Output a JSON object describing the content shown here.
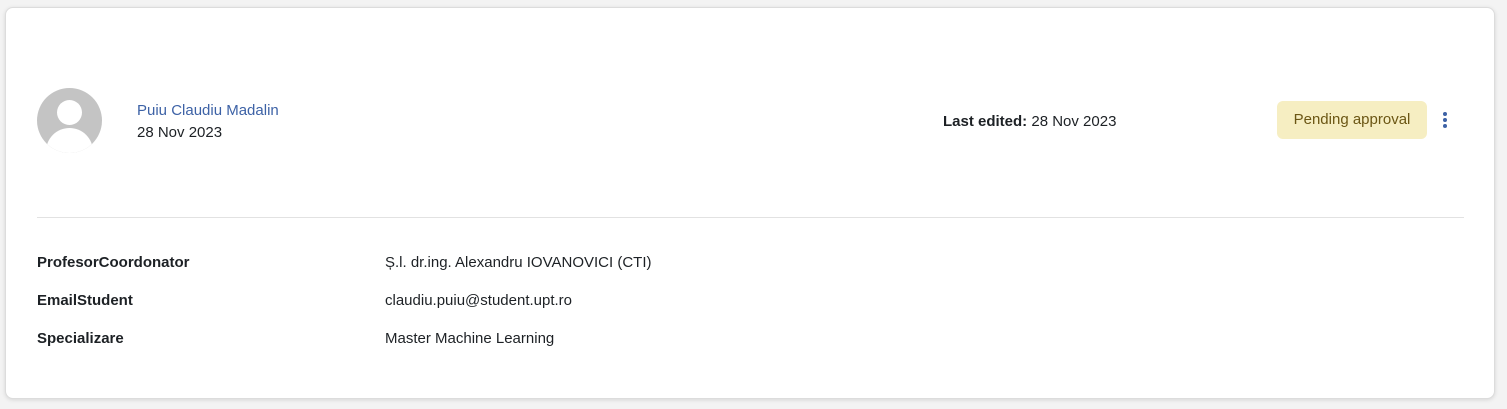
{
  "entry": {
    "author_name": "Puiu Claudiu Madalin",
    "author_date": "28 Nov 2023",
    "last_edited_label": "Last edited:",
    "last_edited_value": "28 Nov 2023",
    "status_badge": "Pending approval",
    "actions_icon": "kebab-menu-icon",
    "avatar_icon": "default-user-avatar"
  },
  "fields": [
    {
      "label": "ProfesorCoordonator",
      "value": "Ș.l. dr.ing. Alexandru IOVANOVICI (CTI)"
    },
    {
      "label": "EmailStudent",
      "value": "claudiu.puiu@student.upt.ro"
    },
    {
      "label": "Specializare",
      "value": "Master Machine Learning"
    }
  ],
  "colors": {
    "link": "#3d62a6",
    "badge_background": "#f6eec2",
    "badge_text": "#6b5614",
    "divider": "#e2e2e2"
  }
}
